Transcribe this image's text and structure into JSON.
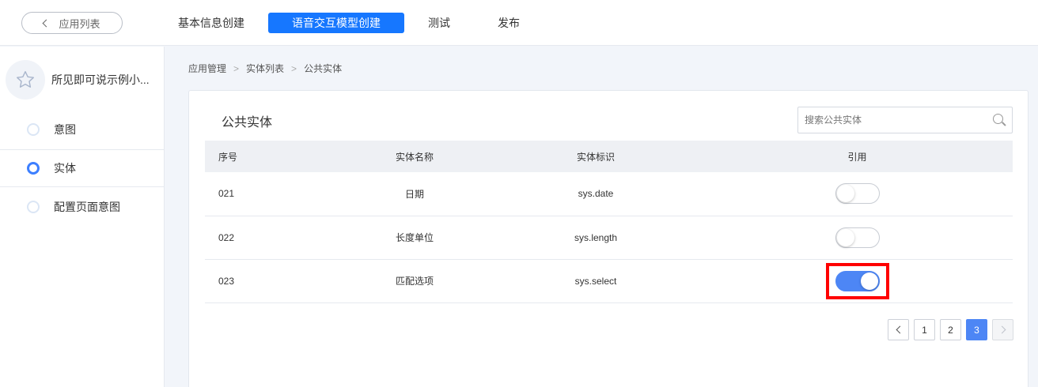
{
  "header": {
    "back_label": "应用列表",
    "tabs": [
      {
        "label": "基本信息创建",
        "active": false
      },
      {
        "label": "语音交互模型创建",
        "active": true
      },
      {
        "label": "测试",
        "active": false
      },
      {
        "label": "发布",
        "active": false
      }
    ],
    "accent_color": "#1677ff"
  },
  "sidebar": {
    "app_name": "所见即可说示例小...",
    "avatar_icon": "star-icon",
    "items": [
      {
        "label": "意图",
        "active": false
      },
      {
        "label": "实体",
        "active": true
      },
      {
        "label": "配置页面意图",
        "active": false
      }
    ]
  },
  "breadcrumb": [
    "应用管理",
    "实体列表",
    "公共实体"
  ],
  "main": {
    "title": "公共实体",
    "search_placeholder": "搜索公共实体",
    "columns": [
      "序号",
      "实体名称",
      "实体标识",
      "引用"
    ],
    "rows": [
      {
        "num": "021",
        "name": "日期",
        "id": "sys.date",
        "enabled": false
      },
      {
        "num": "022",
        "name": "长度单位",
        "id": "sys.length",
        "enabled": false
      },
      {
        "num": "023",
        "name": "匹配选项",
        "id": "sys.select",
        "enabled": true,
        "highlighted": true
      }
    ],
    "pagination": {
      "pages": [
        "1",
        "2",
        "3"
      ],
      "current": "3"
    },
    "switch_on_color": "#4d86f5",
    "highlight_color": "#ff0000"
  }
}
